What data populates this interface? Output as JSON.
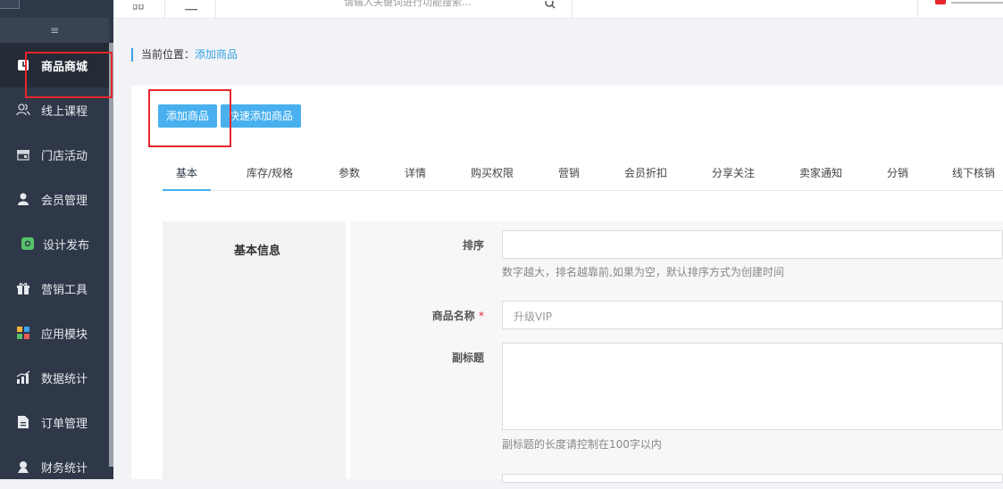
{
  "header": {
    "search_placeholder": "请输入关键词进行功能搜索..."
  },
  "sidebar": {
    "collapse_icon": "≡",
    "items": [
      {
        "label": "商品商城",
        "icon": "store-icon",
        "active": true
      },
      {
        "label": "线上课程",
        "icon": "users-icon"
      },
      {
        "label": "门店活动",
        "icon": "shop-icon"
      },
      {
        "label": "会员管理",
        "icon": "user-icon"
      },
      {
        "label": "设计发布",
        "icon": "design-icon"
      },
      {
        "label": "营销工具",
        "icon": "gift-icon"
      },
      {
        "label": "应用模块",
        "icon": "apps-icon"
      },
      {
        "label": "数据统计",
        "icon": "chart-icon"
      },
      {
        "label": "订单管理",
        "icon": "order-icon"
      },
      {
        "label": "财务统计",
        "icon": "finance-icon"
      }
    ]
  },
  "breadcrumb": {
    "prefix": "当前位置：",
    "current": "添加商品"
  },
  "toolbar": {
    "add_label": "添加商品",
    "quick_add_label": "快速添加商品"
  },
  "tabs": [
    "基本",
    "库存/规格",
    "参数",
    "详情",
    "购买权限",
    "营销",
    "会员折扣",
    "分享关注",
    "卖家通知",
    "分销",
    "线下核销"
  ],
  "form": {
    "section_title": "基本信息",
    "sort": {
      "label": "排序",
      "hint": "数字越大，排名越靠前,如果为空，默认排序方式为创建时间"
    },
    "name": {
      "label": "商品名称",
      "required_mark": "*",
      "placeholder": "升级VIP"
    },
    "subtitle": {
      "label": "副标题",
      "hint": "副标题的长度请控制在100字以内"
    }
  },
  "colors": {
    "accent": "#48b0ef",
    "sidebar": "#2f3848",
    "highlight": "#e6262b"
  }
}
